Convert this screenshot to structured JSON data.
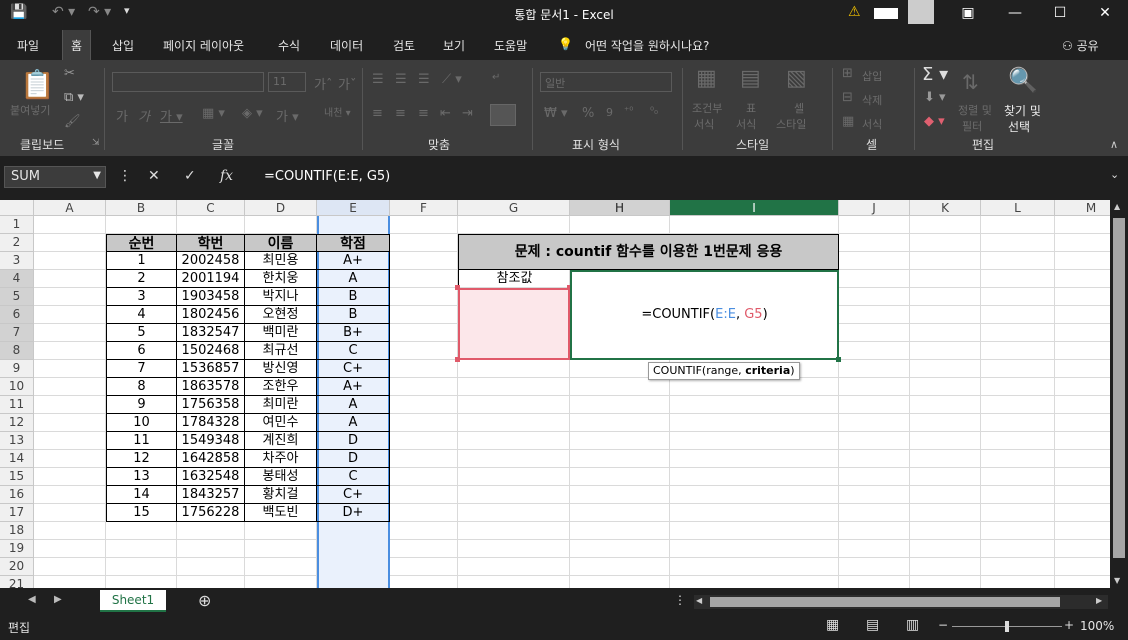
{
  "title": "통합 문서1 - Excel",
  "menu": [
    "파일",
    "홈",
    "삽입",
    "페이지 레이아웃",
    "수식",
    "데이터",
    "검토",
    "보기",
    "도움말"
  ],
  "tell_me": "어떤 작업을 원하시나요?",
  "share": "공유",
  "ribbon": {
    "paste": "붙여넣기",
    "font_size": "11",
    "number_format": "일반",
    "conditional": "조건부",
    "conditional2": "서식",
    "table": "표",
    "table2": "서식",
    "cellstyle": "셀",
    "cellstyle2": "스타일",
    "insert": "삽입",
    "delete": "삭제",
    "format": "서식",
    "sort": "정렬 및",
    "sort2": "필터",
    "find": "찾기 및",
    "find2": "선택",
    "groups": [
      "클립보드",
      "글꼴",
      "맞춤",
      "표시 형식",
      "스타일",
      "셀",
      "편집"
    ]
  },
  "namebox": "SUM",
  "formula": "=COUNTIF(E:E, G5)",
  "columns": [
    "A",
    "B",
    "C",
    "D",
    "E",
    "F",
    "G",
    "H",
    "I",
    "J",
    "K",
    "L",
    "M"
  ],
  "rows": [
    "1",
    "2",
    "3",
    "4",
    "5",
    "6",
    "7",
    "8",
    "9",
    "10",
    "11",
    "12",
    "13",
    "14",
    "15",
    "16",
    "17",
    "18",
    "19",
    "20",
    "21"
  ],
  "table": {
    "headers": [
      "순번",
      "학번",
      "이름",
      "학점"
    ],
    "rows": [
      [
        "1",
        "2002458",
        "최민용",
        "A+"
      ],
      [
        "2",
        "2001194",
        "한치웅",
        "A"
      ],
      [
        "3",
        "1903458",
        "박지나",
        "B"
      ],
      [
        "4",
        "1802456",
        "오현정",
        "B"
      ],
      [
        "5",
        "1832547",
        "백미란",
        "B+"
      ],
      [
        "6",
        "1502468",
        "최규선",
        "C"
      ],
      [
        "7",
        "1536857",
        "방신영",
        "C+"
      ],
      [
        "8",
        "1863578",
        "조한우",
        "A+"
      ],
      [
        "9",
        "1756358",
        "최미란",
        "A"
      ],
      [
        "10",
        "1784328",
        "여민수",
        "A"
      ],
      [
        "11",
        "1549348",
        "계진희",
        "D"
      ],
      [
        "12",
        "1642858",
        "차주아",
        "D"
      ],
      [
        "13",
        "1632548",
        "봉태성",
        "C"
      ],
      [
        "14",
        "1843257",
        "황치걸",
        "C+"
      ],
      [
        "15",
        "1756228",
        "백도빈",
        "D+"
      ]
    ]
  },
  "problem_title": "문제 : countif 함수를 이용한 1번문제 응용",
  "ref_label": "참조값",
  "edit_formula": {
    "prefix": "=COUNTIF(",
    "range": "E:E",
    "mid": ", ",
    "crit": "G5",
    "suffix": ")"
  },
  "tooltip": {
    "text": "COUNTIF(range, ",
    "bold": "criteria",
    "end": ")"
  },
  "sheet_tab": "Sheet1",
  "status": "편집",
  "zoom": "100%",
  "colors": {
    "accent": "#217346",
    "range_blue": "#4a8ee0",
    "crit_red": "#e05a6a"
  }
}
